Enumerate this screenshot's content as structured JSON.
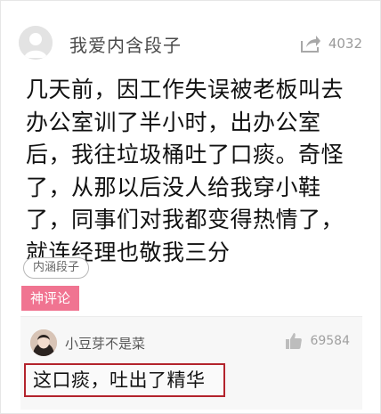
{
  "post": {
    "username": "我爱内含段子",
    "share_count": "4032",
    "content": "几天前，因工作失误被老板叫去办公室训了半小时，出办公室后，我往垃圾桶吐了口痰。奇怪了，从那以后没人给我穿小鞋了，同事们对我都变得热情了，就连经理也敬我三分",
    "tag": "内涵段子",
    "hot_comment_label": "神评论"
  },
  "comment": {
    "username": "小豆芽不是菜",
    "like_count": "69584",
    "text": "这口痰，吐出了精华"
  },
  "icons": {
    "post_avatar": "default-avatar-icon",
    "share": "share-icon",
    "comment_avatar": "user-photo-avatar",
    "like": "thumbs-up-icon"
  },
  "colors": {
    "hot_label_bg": "#f07491",
    "highlight_border": "#b3232c"
  }
}
